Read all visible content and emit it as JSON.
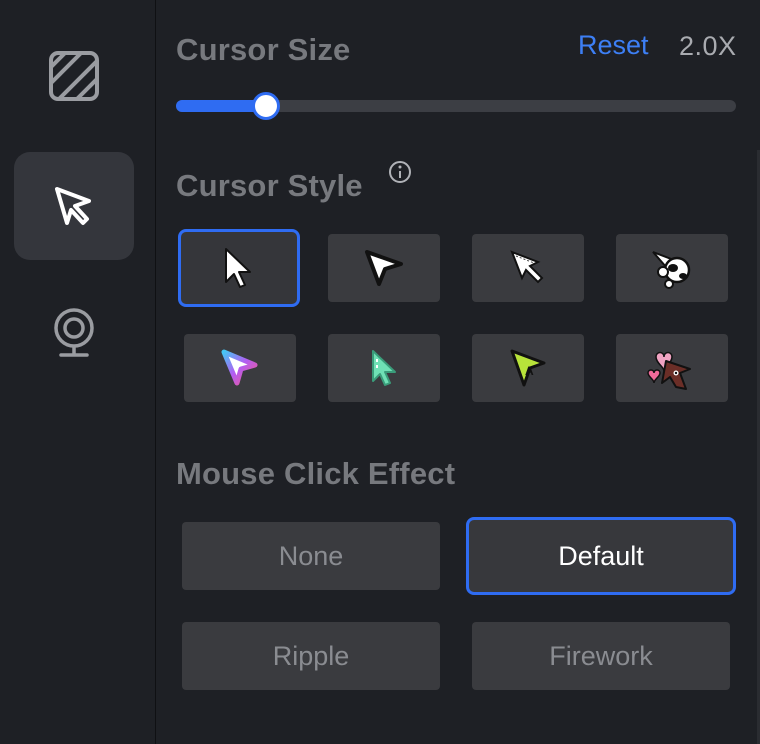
{
  "sidebar": {
    "items": [
      {
        "icon": "background-stripes-icon"
      },
      {
        "icon": "cursor-icon",
        "active": true
      },
      {
        "icon": "webcam-icon"
      }
    ]
  },
  "cursor_size": {
    "title": "Cursor Size",
    "reset_label": "Reset",
    "value_label": "2.0X",
    "slider_fraction": 0.16
  },
  "cursor_style": {
    "title": "Cursor Style",
    "info_icon": "info-icon",
    "styles": [
      {
        "name": "classic-white-arrow-icon",
        "selected": true
      },
      {
        "name": "white-pointer-arrow-icon"
      },
      {
        "name": "pixel-arrow-icon"
      },
      {
        "name": "astronaut-cursor-icon"
      },
      {
        "name": "gradient-arrow-icon"
      },
      {
        "name": "mint-arrow-icon"
      },
      {
        "name": "lime-pointer-icon"
      },
      {
        "name": "bear-hearts-cursor-icon"
      }
    ]
  },
  "click_effect": {
    "title": "Mouse Click Effect",
    "options": [
      {
        "label": "None"
      },
      {
        "label": "Default",
        "selected": true
      },
      {
        "label": "Ripple"
      },
      {
        "label": "Firework"
      }
    ]
  },
  "colors": {
    "accent": "#2f6cf2",
    "reset": "#3d7ff5",
    "background": "#1e2025",
    "tile": "#3a3b3f"
  }
}
